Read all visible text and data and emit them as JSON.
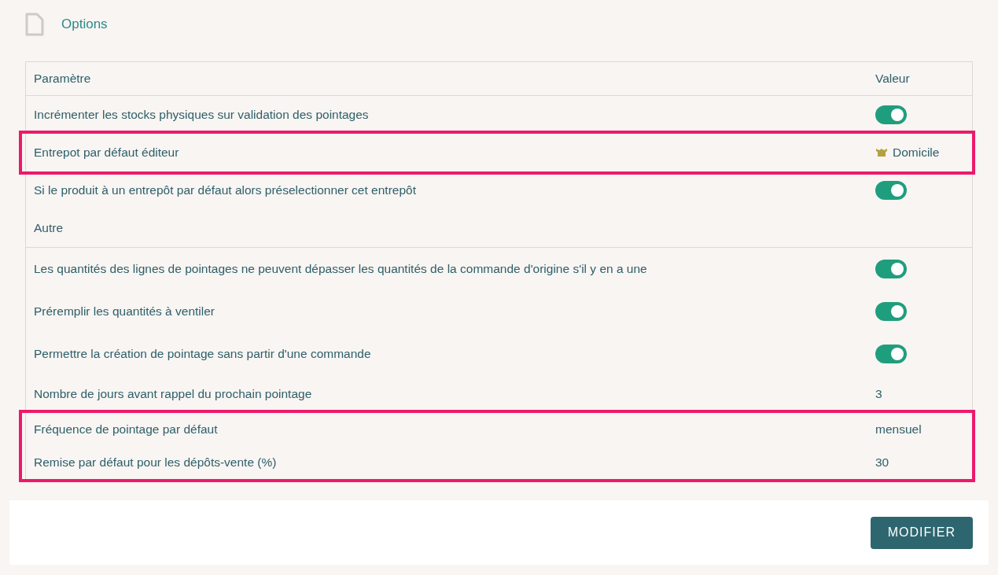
{
  "section": {
    "title": "Options"
  },
  "table": {
    "columns": [
      "Paramètre",
      "Valeur"
    ],
    "groups": [
      {
        "highlighted": false,
        "rows": [
          {
            "kind": "toggle",
            "label": "Incrémenter les stocks physiques sur validation des pointages",
            "on": true
          }
        ]
      },
      {
        "highlighted": true,
        "rows": [
          {
            "kind": "warehouse",
            "label": "Entrepot par défaut éditeur",
            "value": "Domicile"
          }
        ]
      },
      {
        "highlighted": false,
        "rows": [
          {
            "kind": "toggle",
            "label": "Si le produit à un entrepôt par défaut alors préselectionner cet entrepôt",
            "on": true
          },
          {
            "kind": "section",
            "label": "Autre"
          },
          {
            "kind": "toggle",
            "label": "Les quantités des lignes de pointages ne peuvent dépasser les quantités de la commande d'origine s'il y en a une",
            "on": true
          },
          {
            "kind": "toggle",
            "label": "Préremplir les quantités à ventiler",
            "on": true
          },
          {
            "kind": "toggle",
            "label": "Permettre la création de pointage sans partir d'une commande",
            "on": true
          },
          {
            "kind": "text",
            "label": "Nombre de jours avant rappel du prochain pointage",
            "value": "3"
          }
        ]
      },
      {
        "highlighted": true,
        "rows": [
          {
            "kind": "text",
            "label": "Fréquence de pointage par défaut",
            "value": "mensuel"
          },
          {
            "kind": "text",
            "label": "Remise par défaut pour les dépôts-vente (%)",
            "value": "30"
          }
        ]
      }
    ]
  },
  "footer": {
    "button": "MODIFIER"
  }
}
